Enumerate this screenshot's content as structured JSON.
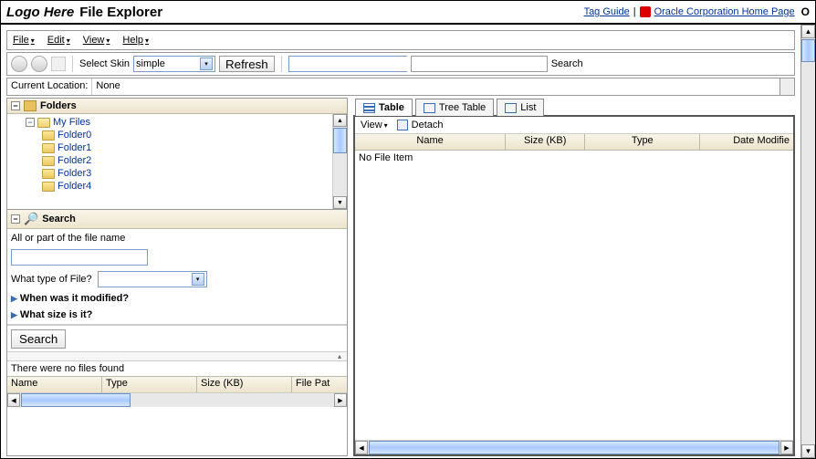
{
  "header": {
    "logo": "Logo Here",
    "title": "File Explorer",
    "links": {
      "tag_guide": "Tag Guide",
      "oracle_home": "Oracle Corporation Home Page"
    },
    "o_label": "O"
  },
  "menubar": {
    "file": "File",
    "edit": "Edit",
    "view": "View",
    "help": "Help"
  },
  "toolbar": {
    "select_skin_label": "Select Skin",
    "skin_value": "simple",
    "refresh": "Refresh",
    "search_label": "Search"
  },
  "location": {
    "label": "Current Location:",
    "value": "None"
  },
  "folders": {
    "header": "Folders",
    "root": "My Files",
    "items": [
      "Folder0",
      "Folder1",
      "Folder2",
      "Folder3",
      "Folder4"
    ]
  },
  "search_panel": {
    "header": "Search",
    "name_label": "All or part of the file name",
    "type_label": "What type of File?",
    "modified_label": "When was it modified?",
    "size_label": "What size is it?",
    "button": "Search"
  },
  "results": {
    "status": "There were no files found",
    "cols": {
      "name": "Name",
      "type": "Type",
      "size": "Size (KB)",
      "path": "File Pat"
    }
  },
  "right": {
    "tabs": {
      "table": "Table",
      "tree_table": "Tree Table",
      "list": "List"
    },
    "view_menu": "View",
    "detach": "Detach",
    "cols": {
      "name": "Name",
      "size": "Size (KB)",
      "type": "Type",
      "date": "Date Modifie"
    },
    "empty": "No File Item"
  }
}
